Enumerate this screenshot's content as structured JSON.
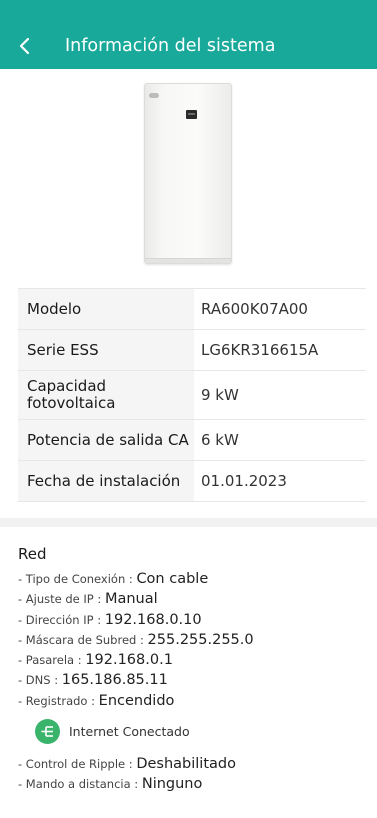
{
  "header": {
    "title": "Información del sistema",
    "back_icon": "chevron-left-icon",
    "bg_color": "#19a99a"
  },
  "product": {
    "image": "ess-device-image"
  },
  "info_table": [
    {
      "label": "Modelo",
      "value": "RA600K07A00"
    },
    {
      "label": "Serie ESS",
      "value": "LG6KR316615A"
    },
    {
      "label": "Capacidad fotovoltaica",
      "value": "9 kW"
    },
    {
      "label": "Potencia de salida CA",
      "value": "6 kW"
    },
    {
      "label": "Fecha de instalación",
      "value": "01.01.2023"
    }
  ],
  "network": {
    "title": "Red",
    "items": [
      {
        "key": "- Tipo de Conexión : ",
        "value": "Con cable"
      },
      {
        "key": "- Ajuste de IP : ",
        "value": "Manual"
      },
      {
        "key": "- Dirección IP : ",
        "value": "192.168.0.10"
      },
      {
        "key": "- Máscara de Subred : ",
        "value": "255.255.255.0"
      },
      {
        "key": "- Pasarela : ",
        "value": "192.168.0.1"
      },
      {
        "key": "- DNS : ",
        "value": "165.186.85.11"
      },
      {
        "key": "- Registrado : ",
        "value": "Encendido"
      }
    ],
    "internet": {
      "icon": "network-icon",
      "label": "Internet Conectado",
      "color": "#3ab36b"
    },
    "extra_items": [
      {
        "key": "- Control de Ripple : ",
        "value": "Deshabilitado"
      },
      {
        "key": "- Mando a distancia : ",
        "value": "Ninguno"
      }
    ]
  }
}
